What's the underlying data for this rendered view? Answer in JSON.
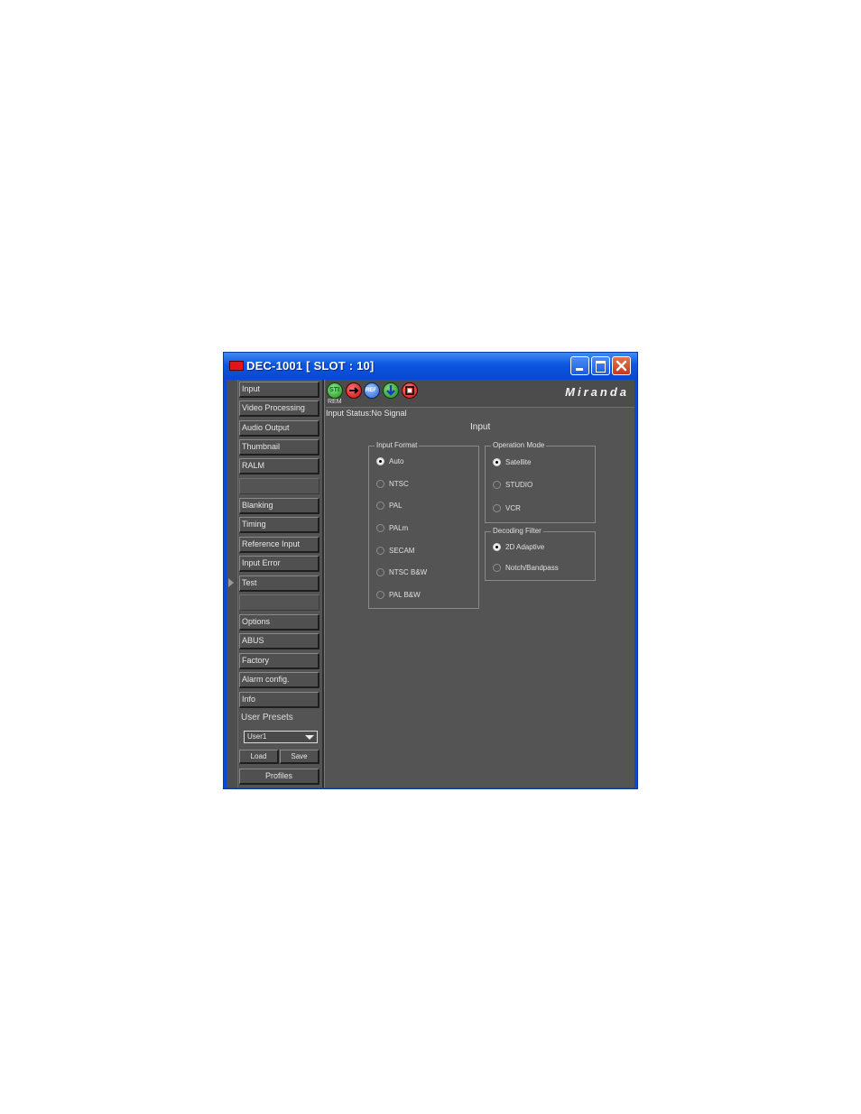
{
  "window": {
    "title": "DEC-1001 [ SLOT : 10]"
  },
  "nav": {
    "items": [
      "Input",
      "Video Processing",
      "Audio Output",
      "Thumbnail",
      "RALM",
      "Blanking",
      "Timing",
      "Reference Input",
      "Input Error",
      "Test",
      "Options",
      "ABUS",
      "Factory",
      "Alarm config.",
      "Info"
    ],
    "user_presets_label": "User Presets",
    "preset_selected": "User1",
    "load_label": "Load",
    "save_label": "Save",
    "profiles_label": "Profiles"
  },
  "status_icons": {
    "sti_label": "STI",
    "ref_label": "REF",
    "rem_label": "REM"
  },
  "brand": "Miranda",
  "status_text": "Input Status:No Signal",
  "page_title": "Input",
  "input_format": {
    "label": "Input Format",
    "options": [
      "Auto",
      "NTSC",
      "PAL",
      "PALm",
      "SECAM",
      "NTSC B&W",
      "PAL B&W"
    ],
    "selected": 0
  },
  "operation_mode": {
    "label": "Operation Mode",
    "options": [
      "Satellite",
      "STUDIO",
      "VCR"
    ],
    "selected": 0
  },
  "decoding_filter": {
    "label": "Decoding Filter",
    "options": [
      "2D Adaptive",
      "Notch/Bandpass"
    ],
    "selected": 0
  },
  "colors": {
    "titlebar": "#0b55e0",
    "panel": "#545454",
    "alarm_red": "#e0141a",
    "ok_green": "#1f8e1b"
  }
}
